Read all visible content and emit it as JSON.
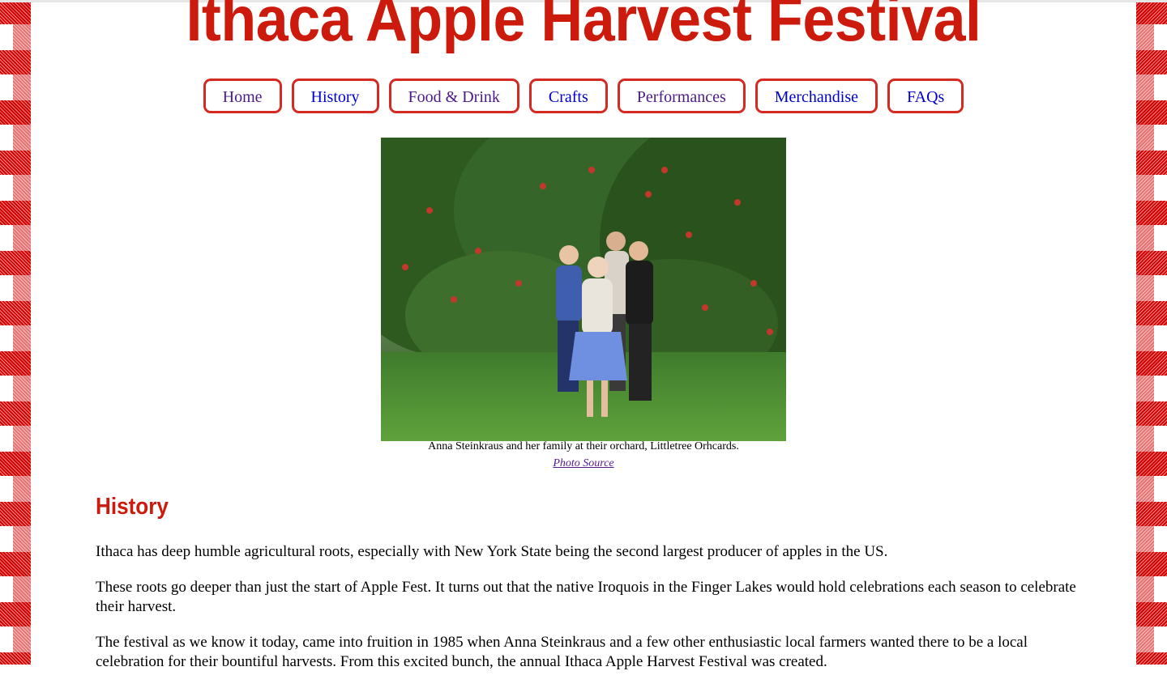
{
  "page": {
    "title": "Ithaca Apple Harvest Festival",
    "accent_color": "#cc1a0c",
    "border_color": "#d40000"
  },
  "nav": {
    "items": [
      {
        "label": "Home",
        "visited": true
      },
      {
        "label": "History",
        "visited": false
      },
      {
        "label": "Food & Drink",
        "visited": true
      },
      {
        "label": "Crafts",
        "visited": false
      },
      {
        "label": "Performances",
        "visited": true
      },
      {
        "label": "Merchandise",
        "visited": false
      },
      {
        "label": "FAQs",
        "visited": false
      }
    ]
  },
  "figure": {
    "caption": "Anna Steinkraus and her family at their orchard, Littletree Orhcards.",
    "source_link": "Photo Source"
  },
  "history": {
    "heading": "History",
    "paragraphs": [
      "Ithaca has deep humble agricultural roots, especially with New York State being the second largest producer of apples in the US.",
      "These roots go deeper than just the start of Apple Fest. It turns out that the native Iroquois in the Finger Lakes would hold celebrations each season to celebrate their harvest.",
      "The festival as we know it today, came into fruition in 1985 when Anna Steinkraus and a few other enthusiastic local farmers wanted there to be a local celebration for their bountiful harvests. From this excited bunch, the annual Ithaca Apple Harvest Festival was created."
    ]
  }
}
